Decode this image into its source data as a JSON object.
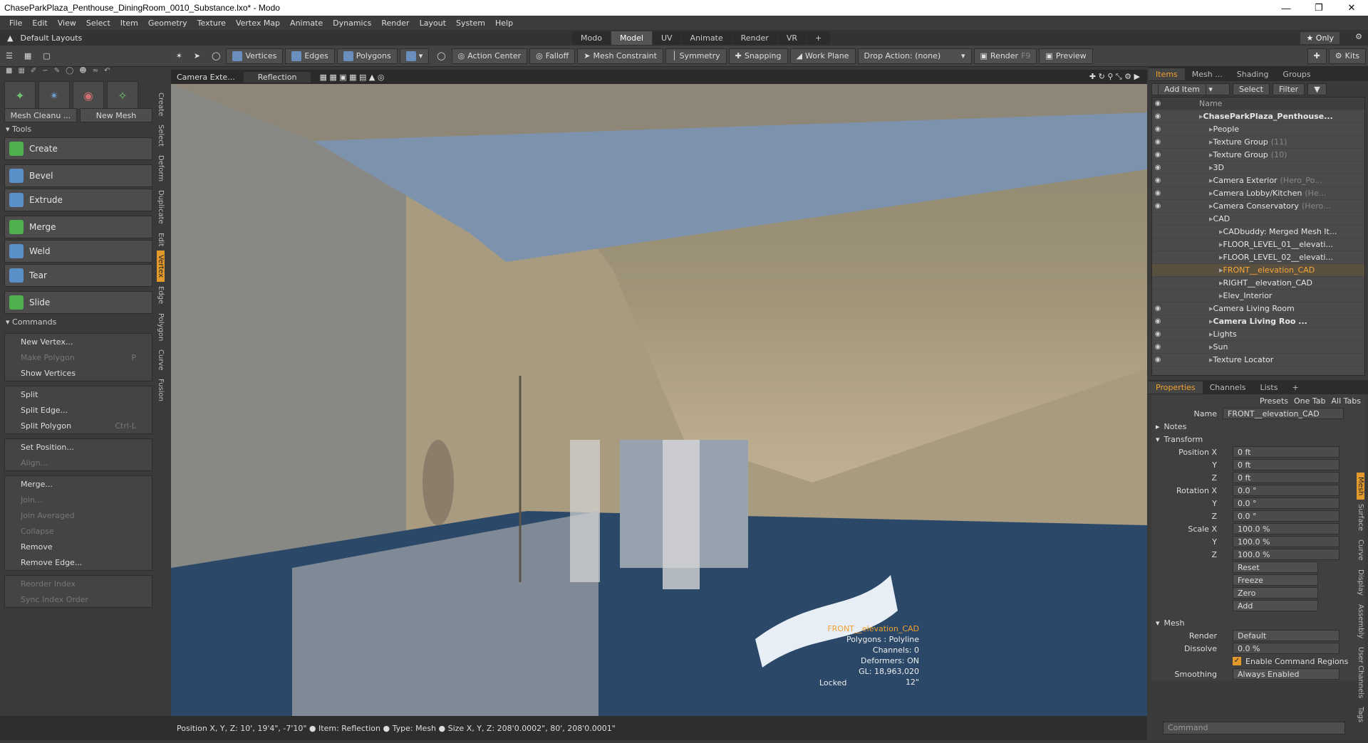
{
  "window": {
    "title": "ChaseParkPlaza_Penthouse_DiningRoom_0010_Substance.lxo* - Modo"
  },
  "menu": [
    "File",
    "Edit",
    "View",
    "Select",
    "Item",
    "Geometry",
    "Texture",
    "Vertex Map",
    "Animate",
    "Dynamics",
    "Render",
    "Layout",
    "System",
    "Help"
  ],
  "layout": {
    "name": "Default Layouts",
    "tabs": [
      "Modo",
      "Model",
      "UV",
      "Animate",
      "Render",
      "VR",
      "+"
    ],
    "active_tab": "Model",
    "only": "Only"
  },
  "toolbar": {
    "vertices": "Vertices",
    "edges": "Edges",
    "polygons": "Polygons",
    "action_center": "Action Center",
    "falloff": "Falloff",
    "mesh_constraint": "Mesh Constraint",
    "symmetry": "Symmetry",
    "snapping": "Snapping",
    "work_plane": "Work Plane",
    "drop_action": "Drop Action: (none)",
    "render": "Render",
    "render_key": "F9",
    "preview": "Preview",
    "kits": "Kits"
  },
  "left": {
    "mesh_cleanup": "Mesh Cleanu ...",
    "new_mesh": "New Mesh",
    "tools_header": "Tools",
    "tools": [
      "Create",
      "Bevel",
      "Extrude",
      "Merge",
      "Weld",
      "Tear",
      "Slide"
    ],
    "commands_header": "Commands",
    "cmds1": [
      {
        "label": "New Vertex...",
        "dis": false
      },
      {
        "label": "Make Polygon",
        "dis": true,
        "key": "P"
      },
      {
        "label": "Show Vertices",
        "dis": false
      }
    ],
    "cmds2": [
      {
        "label": "Split",
        "dis": false
      },
      {
        "label": "Split Edge...",
        "dis": false
      },
      {
        "label": "Split Polygon",
        "dis": false,
        "key": "Ctrl-L"
      }
    ],
    "cmds3": [
      {
        "label": "Set Position...",
        "dis": false
      },
      {
        "label": "Align...",
        "dis": true
      }
    ],
    "cmds4": [
      {
        "label": "Merge...",
        "dis": false
      },
      {
        "label": "Join...",
        "dis": true
      },
      {
        "label": "Join Averaged",
        "dis": true
      },
      {
        "label": "Collapse",
        "dis": true
      },
      {
        "label": "Remove",
        "dis": false
      },
      {
        "label": "Remove Edge...",
        "dis": false
      }
    ],
    "cmds5": [
      {
        "label": "Reorder Index",
        "dis": true
      },
      {
        "label": "Sync Index Order",
        "dis": true
      }
    ],
    "side_tabs": [
      "Create",
      "Select",
      "Deform",
      "Duplicate",
      "Edit",
      "Vertex",
      "Edge",
      "Polygon",
      "Curve",
      "Fusion"
    ]
  },
  "viewport": {
    "camera": "Camera Exte...",
    "reflection": "Reflection",
    "info": {
      "item": "FRONT__elevation_CAD",
      "polygons": "Polygons : Polyline",
      "channels": "Channels: 0",
      "deformers": "Deformers: ON",
      "gl": "GL: 18,963,020",
      "size": "12\""
    },
    "locked": "Locked"
  },
  "status": "Position X, Y, Z:  10', 19'4\", -7'10\"  ● Item:  Reflection ● Type:  Mesh ● Size X, Y, Z:  208'0.0002\", 80', 208'0.0001\"",
  "right": {
    "tabs": [
      "Items",
      "Mesh ...",
      "Shading",
      "Groups"
    ],
    "add_item": "Add Item",
    "select": "Select",
    "filter": "Filter",
    "name_col": "Name",
    "items": [
      {
        "label": "ChaseParkPlaza_Penthouse...",
        "bold": true,
        "indent": 0,
        "eye": true
      },
      {
        "label": "People",
        "indent": 1,
        "eye": true
      },
      {
        "label": "Texture Group",
        "extra": "(11)",
        "indent": 1,
        "eye": true
      },
      {
        "label": "Texture Group",
        "extra": "(10)",
        "indent": 1,
        "eye": true
      },
      {
        "label": "3D",
        "indent": 1,
        "eye": true
      },
      {
        "label": "Camera Exterior",
        "extra": "(Hero_Po...",
        "indent": 1,
        "eye": true
      },
      {
        "label": "Camera Lobby/Kitchen",
        "extra": "(He...",
        "indent": 1,
        "eye": true
      },
      {
        "label": "Camera Conservatory",
        "extra": "(Hero...",
        "indent": 1,
        "eye": true
      },
      {
        "label": "CAD",
        "indent": 1,
        "eye": false
      },
      {
        "label": "CADbuddy: Merged Mesh It...",
        "indent": 2,
        "eye": false
      },
      {
        "label": "FLOOR_LEVEL_01__elevati...",
        "indent": 2,
        "eye": false
      },
      {
        "label": "FLOOR_LEVEL_02__elevati...",
        "indent": 2,
        "eye": false
      },
      {
        "label": "FRONT__elevation_CAD",
        "indent": 2,
        "eye": false,
        "sel": true
      },
      {
        "label": "RIGHT__elevation_CAD",
        "indent": 2,
        "eye": false
      },
      {
        "label": "Elev_Interior",
        "indent": 2,
        "eye": false
      },
      {
        "label": "Camera Living Room",
        "indent": 1,
        "eye": true
      },
      {
        "label": "Camera Living Roo ...",
        "bold": true,
        "indent": 1,
        "eye": true
      },
      {
        "label": "Lights",
        "indent": 1,
        "eye": true
      },
      {
        "label": "Sun",
        "indent": 1,
        "eye": true
      },
      {
        "label": "Texture Locator",
        "indent": 1,
        "eye": true
      }
    ],
    "prop_tabs": [
      "Properties",
      "Channels",
      "Lists",
      "+"
    ],
    "presets": "Presets",
    "one_tab": "One Tab",
    "all_tabs": "All Tabs",
    "name_label": "Name",
    "name_value": "FRONT__elevation_CAD",
    "notes": "Notes",
    "transform": "Transform",
    "props": [
      {
        "l": "Position X",
        "v": "0 ft"
      },
      {
        "l": "Y",
        "v": "0 ft"
      },
      {
        "l": "Z",
        "v": "0 ft"
      },
      {
        "l": "Rotation X",
        "v": "0.0 °"
      },
      {
        "l": "Y",
        "v": "0.0 °"
      },
      {
        "l": "Z",
        "v": "0.0 °"
      },
      {
        "l": "Scale X",
        "v": "100.0 %"
      },
      {
        "l": "Y",
        "v": "100.0 %"
      },
      {
        "l": "Z",
        "v": "100.0 %"
      }
    ],
    "actions": [
      "Reset",
      "Freeze",
      "Zero",
      "Add"
    ],
    "mesh_hdr": "Mesh",
    "render_label": "Render",
    "render_val": "Default",
    "dissolve_label": "Dissolve",
    "dissolve_val": "0.0 %",
    "enable_cmd": "Enable Command Regions",
    "smoothing_label": "Smoothing",
    "smoothing_val": "Always Enabled",
    "side_tabs": [
      "Mesh",
      "Surface",
      "Curve",
      "Display",
      "Assembly",
      "User Channels",
      "Tags"
    ],
    "command_placeholder": "Command"
  },
  "colors": {
    "accent": "#e39a2d",
    "sel": "#f7a73a"
  }
}
